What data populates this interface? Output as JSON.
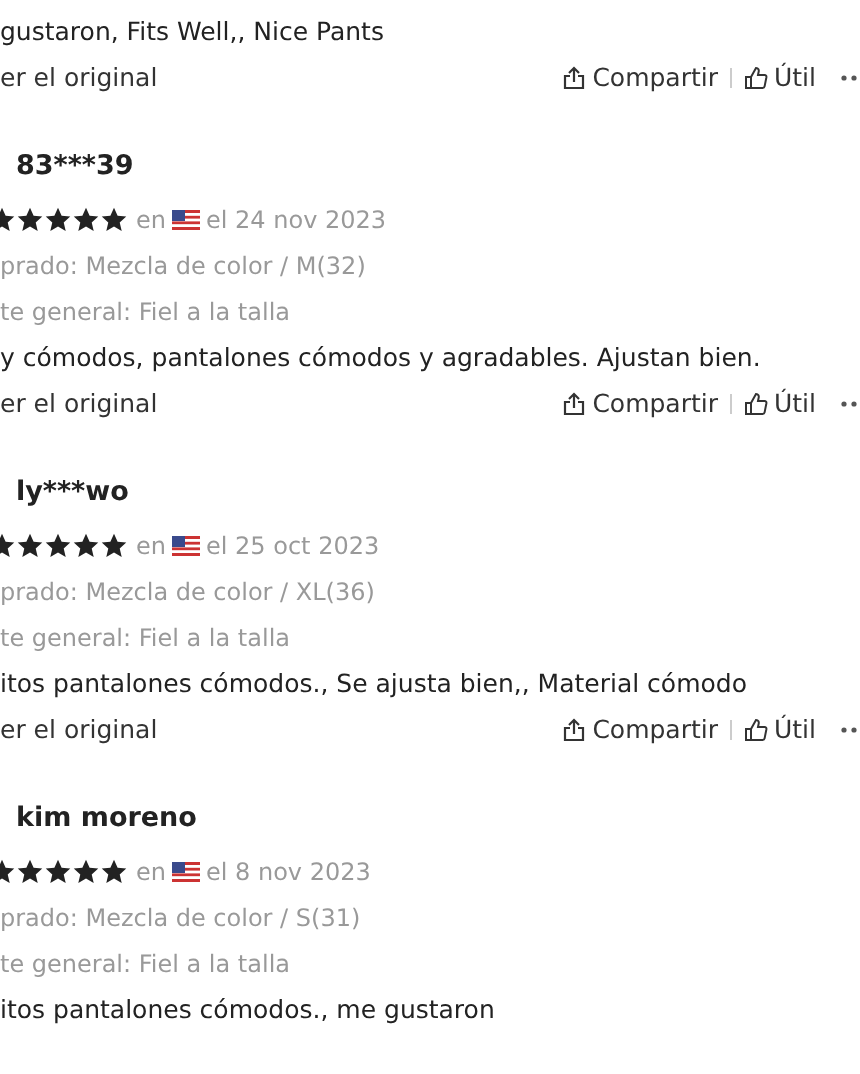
{
  "blocks": [
    {
      "kind": "tail",
      "text": "gustaron, Fits Well,, Nice Pants",
      "translate_link": "er el original",
      "actions": {
        "share": "Compartir",
        "helpful": "Útil"
      }
    },
    {
      "kind": "review",
      "user": "83***39",
      "stars": 5,
      "country_prefix": "en",
      "date": "el 24 nov 2023",
      "purchased": "prado: Mezcla de color / M(32)",
      "fit": "te general: Fiel a la talla",
      "text": "y cómodos, pantalones cómodos y agradables. Ajustan bien.",
      "translate_link": "er el original",
      "actions": {
        "share": "Compartir",
        "helpful": "Útil"
      }
    },
    {
      "kind": "review",
      "user": "ly***wo",
      "stars": 5,
      "country_prefix": "en",
      "date": "el 25 oct 2023",
      "purchased": "prado: Mezcla de color / XL(36)",
      "fit": "te general: Fiel a la talla",
      "text": "itos pantalones cómodos., Se ajusta bien,, Material cómodo",
      "translate_link": "er el original",
      "actions": {
        "share": "Compartir",
        "helpful": "Útil"
      }
    },
    {
      "kind": "review",
      "user": "kim moreno",
      "stars": 5,
      "country_prefix": "en",
      "date": "el 8 nov 2023",
      "purchased": "prado: Mezcla de color / S(31)",
      "fit": "te general: Fiel a la talla",
      "text": "itos pantalones cómodos., me gustaron"
    }
  ]
}
